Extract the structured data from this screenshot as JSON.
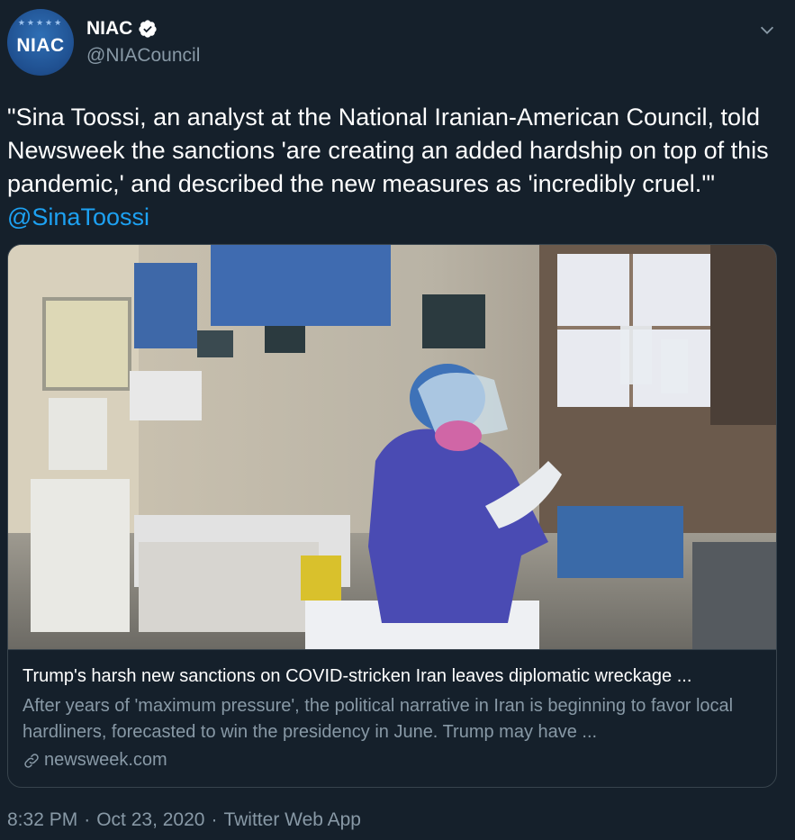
{
  "author": {
    "avatar_text": "NIAC",
    "display_name": "NIAC",
    "handle": "@NIACouncil",
    "verified": true
  },
  "tweet": {
    "text": "\"Sina Toossi, an analyst at the National Iranian-American Council, told Newsweek the sanctions 'are creating an added hardship on top of this pandemic,' and described the new measures as 'incredibly cruel.'\"",
    "mention": "@SinaToossi"
  },
  "card": {
    "image_alt": "Health worker in protective gear in hospital ward",
    "title": "Trump's harsh new sanctions on COVID-stricken Iran leaves diplomatic wreckage ...",
    "description": "After years of 'maximum pressure', the political narrative in Iran is beginning to favor local hardliners, forecasted to win the presidency in June. Trump may have ...",
    "domain": "newsweek.com"
  },
  "meta": {
    "time": "8:32 PM",
    "separator": "·",
    "date": "Oct 23, 2020",
    "source": "Twitter Web App"
  },
  "colors": {
    "background": "#15202b",
    "secondary_text": "#8899a6",
    "accent": "#1da1f2",
    "border": "#38444d"
  },
  "icons": {
    "verified": "verified-badge-icon",
    "caret": "chevron-down-icon",
    "link": "link-icon"
  }
}
